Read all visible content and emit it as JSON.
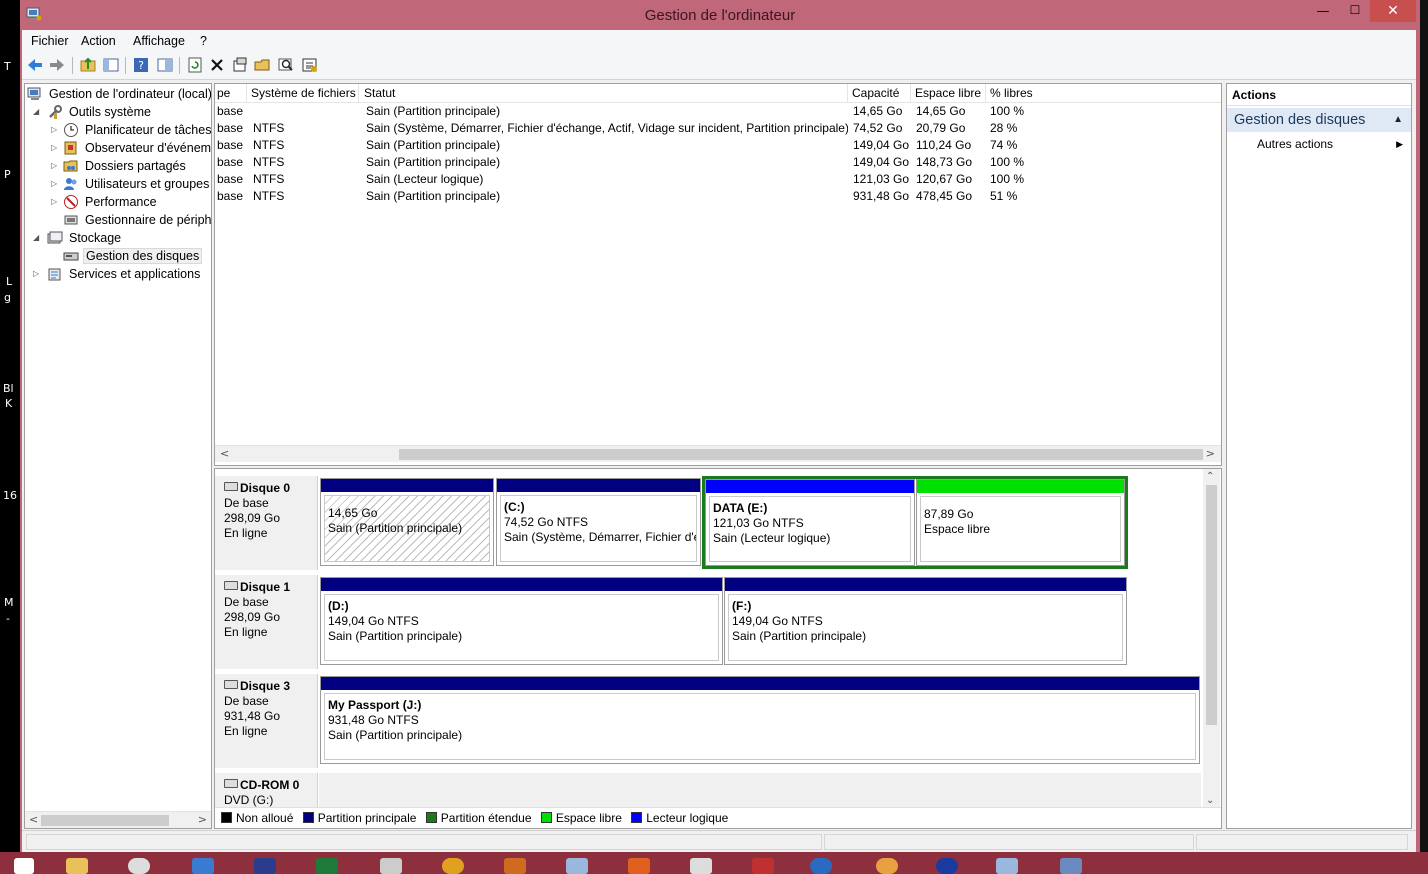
{
  "window": {
    "title": "Gestion de l'ordinateur",
    "min_glyph": "—",
    "max_glyph": "☐",
    "close_glyph": "✕"
  },
  "desktop_fragments": [
    "T",
    "P",
    "L",
    "g",
    "Bl",
    "K",
    "16",
    "M",
    "-"
  ],
  "menu": {
    "items": [
      "Fichier",
      "Action",
      "Affichage",
      "?"
    ]
  },
  "toolbar": {
    "icons": [
      "back-icon",
      "forward-icon",
      "up-folder-icon",
      "console-tree-icon",
      "help-icon",
      "view-icon",
      "refresh-icon",
      "delete-icon",
      "properties-icon",
      "open-icon",
      "search-icon",
      "export-icon"
    ]
  },
  "tree": {
    "root": "Gestion de l'ordinateur (local)",
    "items": [
      {
        "label": "Outils système",
        "expanded": true
      },
      {
        "label": "Planificateur de tâches"
      },
      {
        "label": "Observateur d'événeme"
      },
      {
        "label": "Dossiers partagés"
      },
      {
        "label": "Utilisateurs et groupes l"
      },
      {
        "label": "Performance"
      },
      {
        "label": "Gestionnaire de périphé"
      },
      {
        "label": "Stockage",
        "expanded": true
      },
      {
        "label": "Gestion des disques",
        "selected": true
      },
      {
        "label": "Services et applications"
      }
    ]
  },
  "volumes": {
    "columns": [
      "pe",
      "Système de fichiers",
      "Statut",
      "Capacité",
      "Espace libre",
      "% libres"
    ],
    "rows": [
      [
        "base",
        "",
        "Sain (Partition principale)",
        "14,65 Go",
        "14,65 Go",
        "100 %"
      ],
      [
        "base",
        "NTFS",
        "Sain (Système, Démarrer, Fichier d'échange, Actif, Vidage sur incident, Partition principale)",
        "74,52 Go",
        "20,79 Go",
        "28 %"
      ],
      [
        "base",
        "NTFS",
        "Sain (Partition principale)",
        "149,04 Go",
        "110,24 Go",
        "74 %"
      ],
      [
        "base",
        "NTFS",
        "Sain (Partition principale)",
        "149,04 Go",
        "148,73 Go",
        "100 %"
      ],
      [
        "base",
        "NTFS",
        "Sain (Lecteur logique)",
        "121,03 Go",
        "120,67 Go",
        "100 %"
      ],
      [
        "base",
        "NTFS",
        "Sain (Partition principale)",
        "931,48 Go",
        "478,45 Go",
        "51 %"
      ]
    ]
  },
  "disks": [
    {
      "name": "Disque 0",
      "type": "De base",
      "size": "298,09 Go",
      "state": "En ligne",
      "partitions": [
        {
          "name": "",
          "size": "14,65 Go",
          "status": "Sain (Partition principale)",
          "bar_color": "#000080",
          "hatched": true
        },
        {
          "name": "(C:)",
          "size": "74,52 Go NTFS",
          "status": "Sain (Système, Démarrer, Fichier d'é",
          "bar_color": "#000080"
        },
        {
          "name": "DATA  (E:)",
          "size": "121,03 Go NTFS",
          "status": "Sain (Lecteur logique)",
          "bar_color": "#0000ff"
        },
        {
          "name": "",
          "size": "87,89 Go",
          "status": "Espace libre",
          "bar_color": "#00e000"
        }
      ]
    },
    {
      "name": "Disque 1",
      "type": "De base",
      "size": "298,09 Go",
      "state": "En ligne",
      "partitions": [
        {
          "name": "(D:)",
          "size": "149,04 Go NTFS",
          "status": "Sain (Partition principale)",
          "bar_color": "#000080"
        },
        {
          "name": "(F:)",
          "size": "149,04 Go NTFS",
          "status": "Sain (Partition principale)",
          "bar_color": "#000080"
        }
      ]
    },
    {
      "name": "Disque 3",
      "type": "De base",
      "size": "931,48 Go",
      "state": "En ligne",
      "partitions": [
        {
          "name": "My Passport  (J:)",
          "size": "931,48 Go NTFS",
          "status": "Sain (Partition principale)",
          "bar_color": "#000080"
        }
      ]
    },
    {
      "name": "CD-ROM 0",
      "type": "DVD (G:)"
    }
  ],
  "legend": [
    {
      "label": "Non alloué",
      "color": "#000000"
    },
    {
      "label": "Partition principale",
      "color": "#000080"
    },
    {
      "label": "Partition étendue",
      "color": "#1b7a1b"
    },
    {
      "label": "Espace libre",
      "color": "#00e000"
    },
    {
      "label": "Lecteur logique",
      "color": "#0000ff"
    }
  ],
  "actions": {
    "header": "Actions",
    "group": "Gestion des disques",
    "items": [
      "Autres actions"
    ]
  },
  "colors": {
    "titlebar": "#c0677a",
    "close_button": "#c7504f",
    "selection_group": "#dfe8f5",
    "extended_frame": "#1b7a1b"
  }
}
